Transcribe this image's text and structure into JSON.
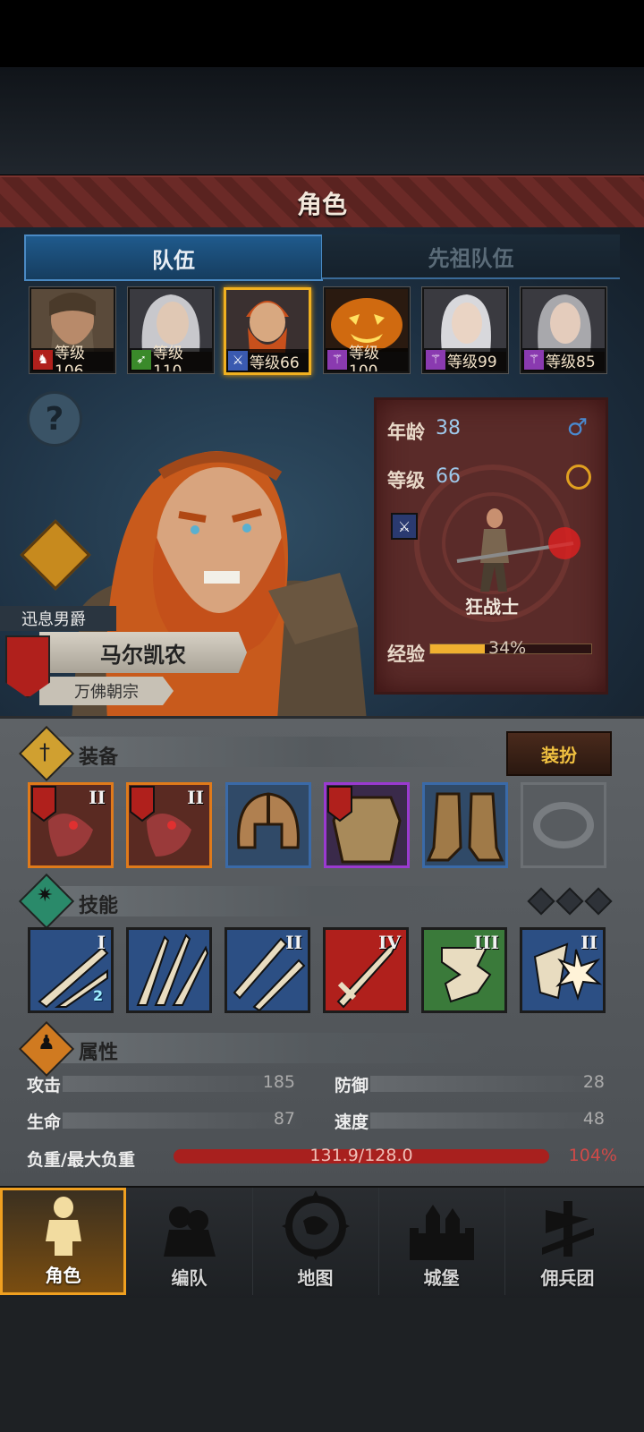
{
  "header": {
    "title": "角色"
  },
  "tabs": [
    {
      "label": "队伍"
    },
    {
      "label": "先祖队伍"
    }
  ],
  "team": [
    {
      "level_label": "等级106",
      "class_icon": "horse-icon",
      "class_color": "#b0201c"
    },
    {
      "level_label": "等级110",
      "class_icon": "bow-icon",
      "class_color": "#3a8a2a"
    },
    {
      "level_label": "等级66",
      "class_icon": "sword-icon",
      "class_color": "#3a5ab0"
    },
    {
      "level_label": "等级100",
      "class_icon": "staff-icon",
      "class_color": "#8a3ab0"
    },
    {
      "level_label": "等级99",
      "class_icon": "staff-icon",
      "class_color": "#8a3ab0"
    },
    {
      "level_label": "等级85",
      "class_icon": "staff-icon",
      "class_color": "#8a3ab0"
    }
  ],
  "character": {
    "title": "迅息男爵",
    "name": "马尔凯农",
    "sect": "万佛朝宗",
    "age_label": "年龄",
    "age": "38",
    "level_label": "等级",
    "level": "66",
    "class_name": "狂战士",
    "exp_label": "经验",
    "exp_percent": "34%",
    "exp_fraction": 0.34
  },
  "equipment": {
    "label": "装备",
    "dress_button": "装扮",
    "slots": [
      {
        "item": "axe-icon",
        "tier": "II",
        "rarity": "orange"
      },
      {
        "item": "axe-icon",
        "tier": "II",
        "rarity": "orange"
      },
      {
        "item": "helmet-icon",
        "tier": "",
        "rarity": "blue"
      },
      {
        "item": "armor-icon",
        "tier": "",
        "rarity": "purple"
      },
      {
        "item": "boots-icon",
        "tier": "",
        "rarity": "blue"
      },
      {
        "item": "ring-icon",
        "tier": "",
        "rarity": "empty"
      }
    ]
  },
  "skills": {
    "label": "技能",
    "items": [
      {
        "icon": "slash-icon",
        "tier": "I",
        "badge": "2",
        "color": "#2c4f84"
      },
      {
        "icon": "claw-icon",
        "tier": "",
        "badge": "",
        "color": "#2c4f84"
      },
      {
        "icon": "dual-sword-icon",
        "tier": "II",
        "badge": "",
        "color": "#2c4f84"
      },
      {
        "icon": "sword-icon",
        "tier": "IV",
        "badge": "",
        "color": "#b0201c"
      },
      {
        "icon": "fist-icon",
        "tier": "III",
        "badge": "",
        "color": "#3a7a3a"
      },
      {
        "icon": "shield-burst-icon",
        "tier": "II",
        "badge": "",
        "color": "#2c4f84"
      }
    ]
  },
  "attributes": {
    "label": "属性",
    "attack_label": "攻击",
    "attack": "185",
    "defense_label": "防御",
    "defense": "28",
    "hp_label": "生命",
    "hp": "87",
    "speed_label": "速度",
    "speed": "48",
    "load_label": "负重/最大负重",
    "load_value": "131.9/128.0",
    "load_percent": "104%"
  },
  "nav": [
    {
      "label": "角色",
      "icon": "knight-icon"
    },
    {
      "label": "编队",
      "icon": "squad-icon"
    },
    {
      "label": "地图",
      "icon": "compass-icon"
    },
    {
      "label": "城堡",
      "icon": "castle-icon"
    },
    {
      "label": "佣兵团",
      "icon": "banner-icon"
    }
  ]
}
